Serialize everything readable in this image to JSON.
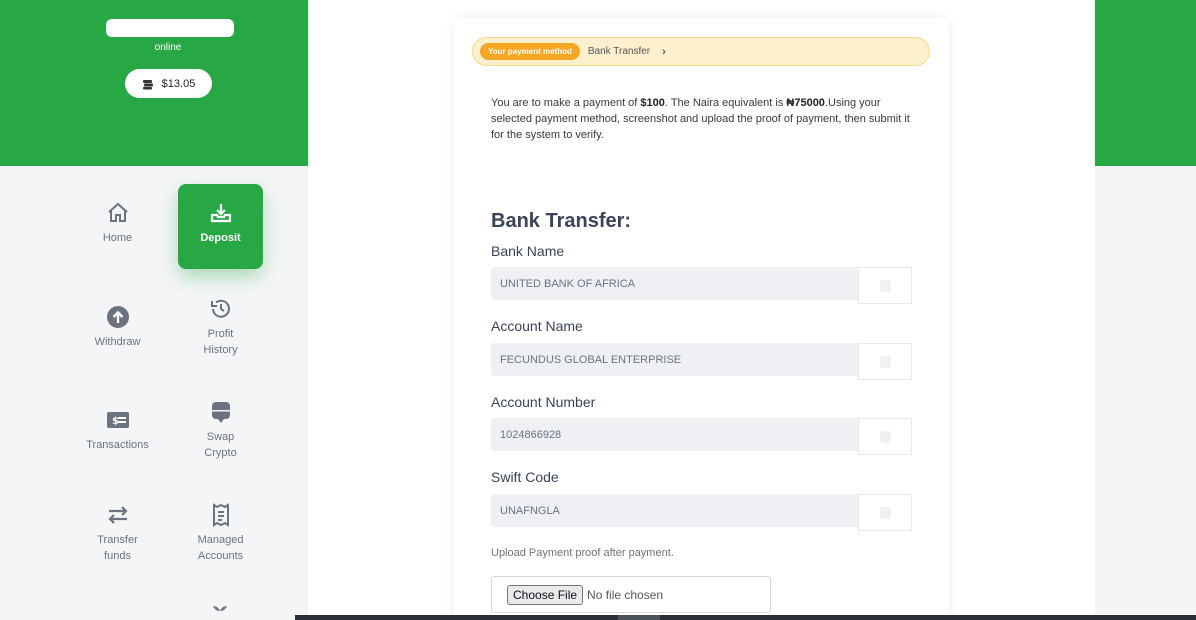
{
  "sidebar": {
    "status": "online",
    "balance": "$13.05",
    "nav": [
      {
        "label": "Home"
      },
      {
        "label": "Deposit"
      },
      {
        "label": "Withdraw"
      },
      {
        "label_line1": "Profit",
        "label_line2": "History"
      },
      {
        "label": "Transactions"
      },
      {
        "label_line1": "Swap",
        "label_line2": "Crypto"
      },
      {
        "label_line1": "Transfer",
        "label_line2": "funds"
      },
      {
        "label_line1": "Managed",
        "label_line2": "Accounts"
      }
    ]
  },
  "payment": {
    "method_badge": "Your payment method",
    "method_name": "Bank Transfer",
    "intro_pre": "You are to make a payment of ",
    "amount": "$100",
    "intro_mid": ". The Naira equivalent is ",
    "naira_amount": "₦75000",
    "intro_post": ".Using your selected payment method, screenshot and upload the proof of payment, then submit it for the system to verify.",
    "section_title": "Bank Transfer:",
    "fields": [
      {
        "label": "Bank Name",
        "value": "UNITED BANK OF AFRICA"
      },
      {
        "label": "Account Name",
        "value": "FECUNDUS GLOBAL ENTERPRISE"
      },
      {
        "label": "Account Number",
        "value": "1024866928"
      },
      {
        "label": "Swift Code",
        "value": "UNAFNGLA"
      }
    ],
    "upload_label": "Upload Payment proof after payment.",
    "file_button": "Choose File",
    "file_status": "No file chosen"
  },
  "colors": {
    "brand_green": "#28a745",
    "badge_orange": "#f5a623",
    "method_bar_bg": "#fdf0cf"
  }
}
